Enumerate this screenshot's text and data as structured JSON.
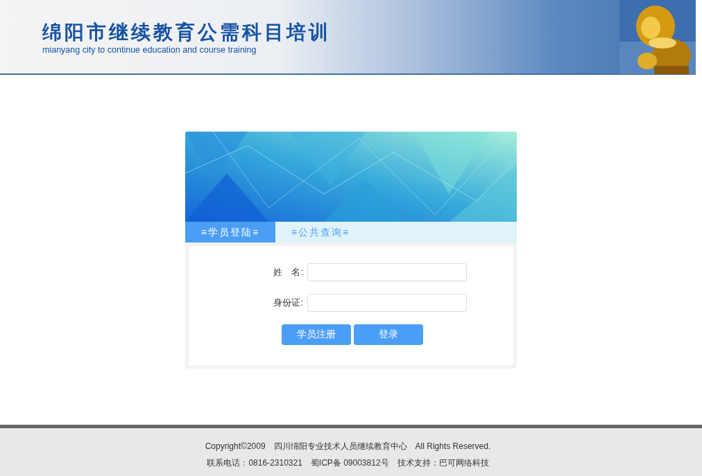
{
  "header": {
    "title": "绵阳市继续教育公需科目培训",
    "subtitle": "mianyang city to continue education and course training"
  },
  "login_card": {
    "tabs": [
      {
        "label": "≡学员登陆≡",
        "selected": true
      },
      {
        "label": "≡公共查询≡",
        "selected": false
      }
    ],
    "fields": [
      {
        "label": "姓　名:"
      },
      {
        "label": "身份证:"
      }
    ],
    "buttons": [
      "学员注册",
      "登录"
    ]
  },
  "footer": {
    "lines": [
      "Copyright©2009　四川绵阳专业技术人员继续教育中心　All Rights Reserved.",
      "联系电话：0816-2310321　蜀ICP备 09003812号　技术支持：巴可网络科技"
    ]
  }
}
